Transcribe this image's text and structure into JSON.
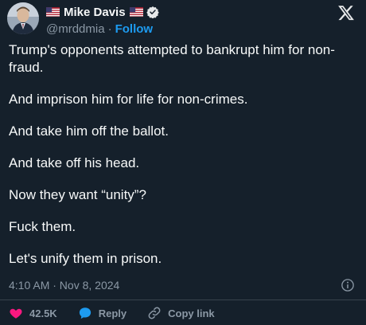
{
  "author": {
    "name": "Mike Davis",
    "handle": "@mrddmia",
    "separator": "·",
    "follow_label": "Follow"
  },
  "tweet": {
    "paragraphs": [
      "Trump's opponents attempted to bankrupt him for non-\nfraud.",
      "And imprison him for life for non-crimes.",
      "And take him off the ballot.",
      "And take off his head.",
      "Now they want “unity”?",
      "Fuck them.",
      "Let's unify them in prison."
    ],
    "timestamp": "4:10 AM · Nov 8, 2024"
  },
  "actions": {
    "likes": "42.5K",
    "reply_label": "Reply",
    "copy_link_label": "Copy link"
  },
  "colors": {
    "background": "#15202b",
    "accent": "#1d9bf0",
    "like": "#f91880",
    "muted": "#8b98a5"
  },
  "icons": [
    "us-flag-icon",
    "verified-badge-icon",
    "x-logo-icon",
    "info-icon",
    "heart-icon",
    "reply-bubble-icon",
    "link-icon"
  ]
}
